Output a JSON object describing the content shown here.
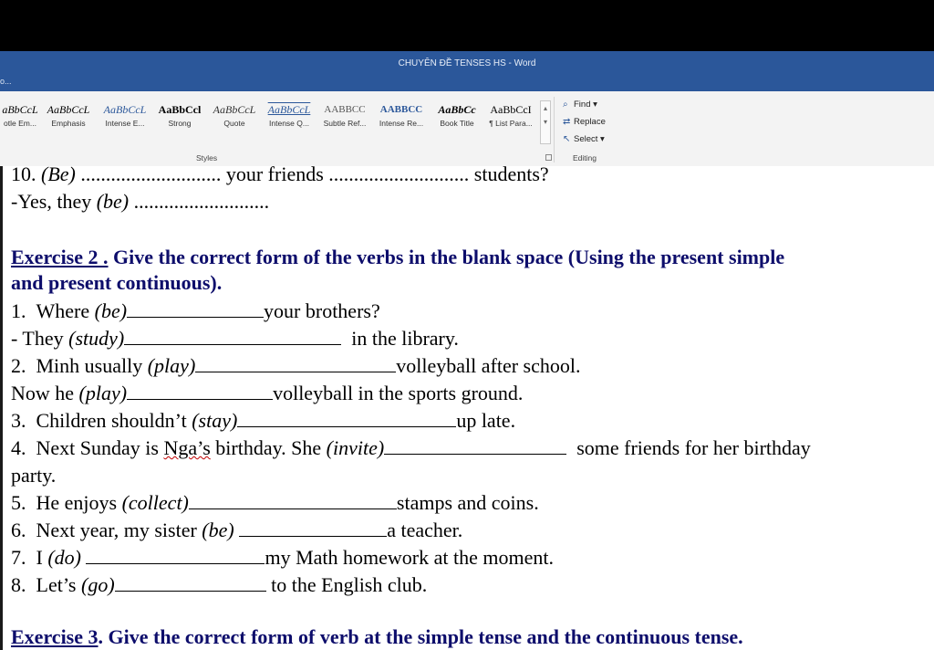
{
  "window": {
    "title": "CHUYÊN ĐỀ TENSES HS - Word",
    "quick_access": "o..."
  },
  "ribbon": {
    "styles": [
      {
        "sample": "aBbCcL",
        "name": "otle Em..."
      },
      {
        "sample": "AaBbCcL",
        "name": "Emphasis"
      },
      {
        "sample": "AaBbCcL",
        "name": "Intense E..."
      },
      {
        "sample": "AaBbCcl",
        "name": "Strong"
      },
      {
        "sample": "AaBbCcL",
        "name": "Quote"
      },
      {
        "sample": "AaBbCcL",
        "name": "Intense Q..."
      },
      {
        "sample": "AABBCC",
        "name": "Subtle Ref..."
      },
      {
        "sample": "AABBCC",
        "name": "Intense Re..."
      },
      {
        "sample": "AaBbCc",
        "name": "Book Title"
      },
      {
        "sample": "AaBbCcI",
        "name": "¶ List Para..."
      }
    ],
    "styles_group_label": "Styles",
    "editing": {
      "find": "Find",
      "replace": "Replace",
      "select": "Select",
      "group_label": "Editing"
    }
  },
  "document": {
    "q10": {
      "prefix": "10. ",
      "verb": "(Be)",
      "dots1": "............................",
      "mid": " your friends ",
      "dots2": "............................",
      "end": " students?"
    },
    "q10_answer": {
      "prefix": "-Yes, they ",
      "verb": "(be)",
      "dots": "..........................."
    },
    "exercise2": {
      "number": "Exercise 2 .",
      "text": " Give the correct form of the verbs in the blank space (Using the present simple",
      "text2": "and present continuous)."
    },
    "items": [
      {
        "num": "1.",
        "pre": "Where ",
        "verb": "(be)",
        "post": "your brothers?"
      },
      {
        "num": "",
        "pre": "- They ",
        "verb": "(study)",
        "post": "in the library."
      },
      {
        "num": "2.",
        "pre": "Minh usually ",
        "verb": "(play)",
        "post": "volleyball after school."
      },
      {
        "num": "",
        "pre": "Now he ",
        "verb": "(play)",
        "post": "volleyball in the sports ground."
      },
      {
        "num": "3.",
        "pre": "Children shouldn’t ",
        "verb": "(stay)",
        "post": "up late."
      },
      {
        "num": "4.",
        "pre": "Next Sunday is ",
        "spell": "Nga’s",
        "pre2": " birthday. She ",
        "verb": "(invite)",
        "post": "some friends for her birthday"
      },
      {
        "num": "",
        "pre": "party.",
        "verb": "",
        "post": ""
      },
      {
        "num": "5.",
        "pre": "He enjoys ",
        "verb": "(collect)",
        "post": "stamps and coins."
      },
      {
        "num": "6.",
        "pre": "Next year, my sister ",
        "verb": "(be)",
        "post": "a teacher."
      },
      {
        "num": "7.",
        "pre": "I ",
        "verb": "(do)",
        "post": "my Math homework at the moment."
      },
      {
        "num": "8.",
        "pre": "Let’s ",
        "verb": "(go)",
        "post": " to the English club."
      }
    ],
    "exercise3": {
      "number": "Exercise 3",
      "text": ". Give the correct form of verb at the simple tense and the continuous tense."
    }
  },
  "colors": {
    "titlebar": "#2b579a",
    "ribbon": "#f3f3f3",
    "heading": "#0d0d6b",
    "accent_style": "#2b579a"
  }
}
